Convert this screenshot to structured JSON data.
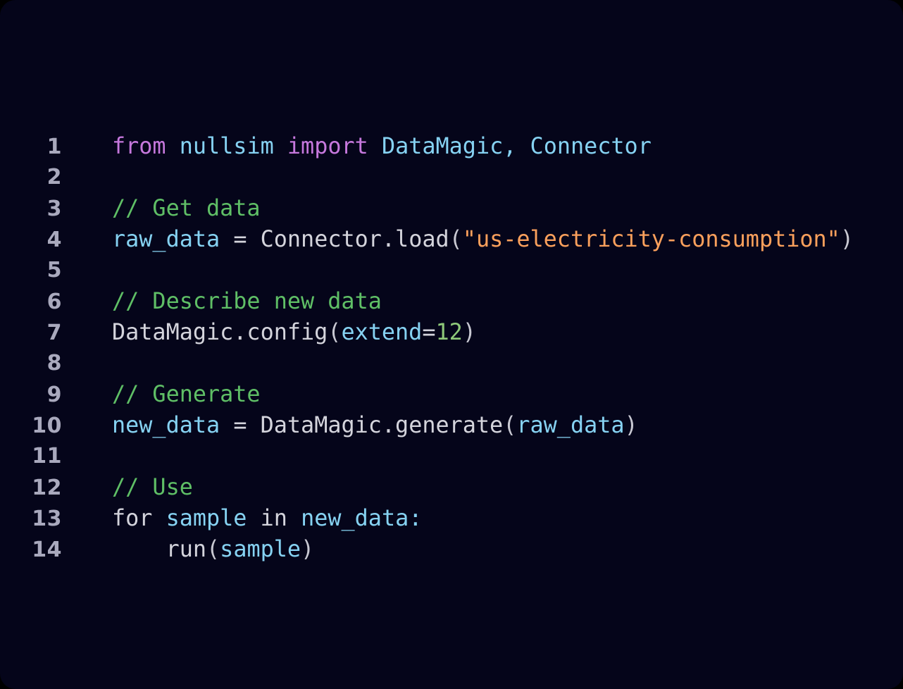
{
  "editor": {
    "background_color": "#05051a",
    "outer_background_color": "#000000",
    "corner_radius_px": 22,
    "gutter_color": "#a9a9bd",
    "font_size_px": 31.8,
    "line_height_px": 44,
    "language": "python",
    "first_line_number": 1,
    "last_line_number": 14,
    "total_lines": 14
  },
  "palette": {
    "plain": "#d4d4dc",
    "keyword": "#c678dd",
    "comment": "#5fbf66",
    "variable": "#86d2f2",
    "string": "#fba05c",
    "number": "#8fc97a",
    "punctuation": "#c8c8d2"
  },
  "lines": [
    {
      "number": "1",
      "text": "from nullsim import DataMagic, Connector",
      "tokens": [
        {
          "text": "from",
          "kind": "keyword"
        },
        {
          "text": " ",
          "kind": "plain"
        },
        {
          "text": "nullsim",
          "kind": "variable"
        },
        {
          "text": " ",
          "kind": "plain"
        },
        {
          "text": "import",
          "kind": "keyword"
        },
        {
          "text": " ",
          "kind": "plain"
        },
        {
          "text": "DataMagic",
          "kind": "variable"
        },
        {
          "text": ",",
          "kind": "variable"
        },
        {
          "text": " ",
          "kind": "plain"
        },
        {
          "text": "Connector",
          "kind": "variable"
        }
      ]
    },
    {
      "number": "2",
      "text": "",
      "tokens": []
    },
    {
      "number": "3",
      "text": "// Get data",
      "tokens": [
        {
          "text": "// Get data",
          "kind": "comment"
        }
      ]
    },
    {
      "number": "4",
      "text": "raw_data = Connector.load(\"us-electricity-consumption\")",
      "tokens": [
        {
          "text": "raw_data",
          "kind": "variable"
        },
        {
          "text": " ",
          "kind": "plain"
        },
        {
          "text": "=",
          "kind": "plain"
        },
        {
          "text": " ",
          "kind": "plain"
        },
        {
          "text": "Connector.load",
          "kind": "plain"
        },
        {
          "text": "(",
          "kind": "punctuation"
        },
        {
          "text": "\"us-electricity-consumption\"",
          "kind": "string"
        },
        {
          "text": ")",
          "kind": "punctuation"
        }
      ]
    },
    {
      "number": "5",
      "text": "",
      "tokens": []
    },
    {
      "number": "6",
      "text": "// Describe new data",
      "tokens": [
        {
          "text": "// Describe new data",
          "kind": "comment"
        }
      ]
    },
    {
      "number": "7",
      "text": "DataMagic.config(extend=12)",
      "tokens": [
        {
          "text": "DataMagic.config",
          "kind": "plain"
        },
        {
          "text": "(",
          "kind": "punctuation"
        },
        {
          "text": "extend",
          "kind": "variable"
        },
        {
          "text": "=",
          "kind": "plain"
        },
        {
          "text": "12",
          "kind": "number"
        },
        {
          "text": ")",
          "kind": "punctuation"
        }
      ]
    },
    {
      "number": "8",
      "text": "",
      "tokens": []
    },
    {
      "number": "9",
      "text": "// Generate",
      "tokens": [
        {
          "text": "// Generate",
          "kind": "comment"
        }
      ]
    },
    {
      "number": "10",
      "text": "new_data = DataMagic.generate(raw_data)",
      "tokens": [
        {
          "text": "new_data",
          "kind": "variable"
        },
        {
          "text": " ",
          "kind": "plain"
        },
        {
          "text": "=",
          "kind": "plain"
        },
        {
          "text": " ",
          "kind": "plain"
        },
        {
          "text": "DataMagic.generate",
          "kind": "plain"
        },
        {
          "text": "(",
          "kind": "punctuation"
        },
        {
          "text": "raw_data",
          "kind": "variable"
        },
        {
          "text": ")",
          "kind": "punctuation"
        }
      ]
    },
    {
      "number": "11",
      "text": "",
      "tokens": []
    },
    {
      "number": "12",
      "text": "// Use",
      "tokens": [
        {
          "text": "// Use",
          "kind": "comment"
        }
      ]
    },
    {
      "number": "13",
      "text": "for sample in new_data:",
      "tokens": [
        {
          "text": "for",
          "kind": "plain"
        },
        {
          "text": " ",
          "kind": "plain"
        },
        {
          "text": "sample",
          "kind": "variable"
        },
        {
          "text": " ",
          "kind": "plain"
        },
        {
          "text": "in",
          "kind": "plain"
        },
        {
          "text": " ",
          "kind": "plain"
        },
        {
          "text": "new_data",
          "kind": "variable"
        },
        {
          "text": ":",
          "kind": "variable"
        }
      ]
    },
    {
      "number": "14",
      "text": "    run(sample)",
      "tokens": [
        {
          "text": "    run",
          "kind": "plain"
        },
        {
          "text": "(",
          "kind": "punctuation"
        },
        {
          "text": "sample",
          "kind": "variable"
        },
        {
          "text": ")",
          "kind": "punctuation"
        }
      ]
    }
  ]
}
